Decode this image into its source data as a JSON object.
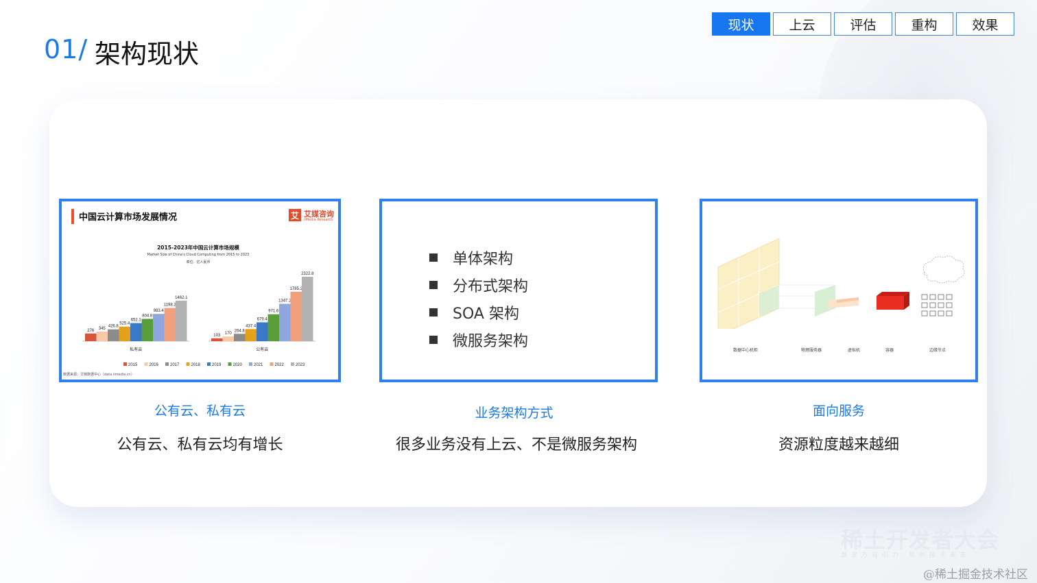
{
  "header": {
    "number": "01/",
    "title": "架构现状"
  },
  "tabs": [
    {
      "label": "现状",
      "active": true
    },
    {
      "label": "上云",
      "active": false
    },
    {
      "label": "评估",
      "active": false
    },
    {
      "label": "重构",
      "active": false
    },
    {
      "label": "效果",
      "active": false
    }
  ],
  "columns": [
    {
      "caption": "公有云、私有云",
      "description": "公有云、私有云均有增长"
    },
    {
      "caption": "业务架构方式",
      "description": "很多业务没有上云、不是微服务架构"
    },
    {
      "caption": "面向服务",
      "description": "资源粒度越来越细"
    }
  ],
  "chart_panel": {
    "heading": "中国云计算市场发展情况",
    "logo_name": "艾媒咨询",
    "logo_sub": "iiMedia Research",
    "logo_mark": "艾"
  },
  "chart_data": {
    "type": "bar",
    "title": "2015-2023年中国云计算市场规模",
    "subtitle": "Market Size of China's Cloud Computing from 2015 to 2023",
    "unit": "单位：亿人民币",
    "categories": [
      "私有云",
      "公有云"
    ],
    "series": [
      {
        "name": "2015",
        "color": "#d9553a",
        "values": [
          276,
          103
        ]
      },
      {
        "name": "2016",
        "color": "#f7c9a8",
        "values": [
          345,
          170
        ]
      },
      {
        "name": "2017",
        "color": "#8c8c8c",
        "values": [
          426.8,
          264.8
        ]
      },
      {
        "name": "2018",
        "color": "#e6a11a",
        "values": [
          525.4,
          437.4
        ]
      },
      {
        "name": "2019",
        "color": "#3a78c8",
        "values": [
          652.1,
          679.4
        ]
      },
      {
        "name": "2020",
        "color": "#5a9e3a",
        "values": [
          804.8,
          971.6
        ]
      },
      {
        "name": "2021",
        "color": "#8fa7e0",
        "values": [
          983.4,
          1347.2
        ]
      },
      {
        "name": "2022",
        "color": "#f1a07e",
        "values": [
          1198.2,
          1785.2
        ]
      },
      {
        "name": "2023",
        "color": "#b3b3b3",
        "values": [
          1462.1,
          2322.8
        ]
      }
    ],
    "ylim": [
      0,
      2322.8
    ],
    "legend": "bottom",
    "source": "数据来源：艾媒数据中心（data.iimedia.cn）"
  },
  "list_panel": {
    "items": [
      "单体架构",
      "分布式架构",
      "SOA 架构",
      "微服务架构"
    ]
  },
  "diagram_panel": {
    "labels": [
      "数据中心机柜",
      "物理服务器",
      "虚拟机",
      "容器",
      "边缘节点"
    ]
  },
  "watermark": {
    "main": "稀土开发者大会",
    "sub": "激发万有引力·共创技术未来"
  },
  "credit": "@稀土掘金技术社区"
}
